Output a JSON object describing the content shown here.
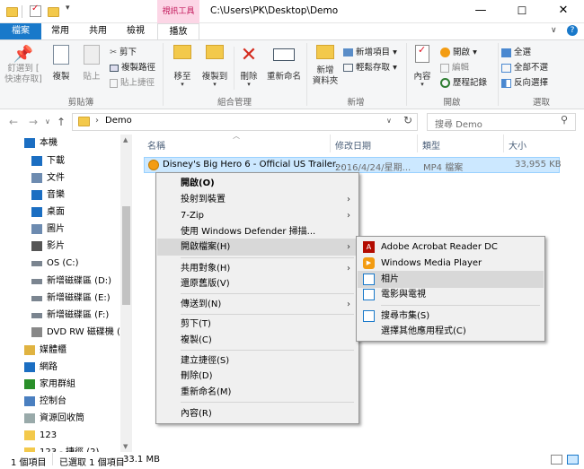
{
  "window": {
    "context_tab_group": "視訊工具",
    "path": "C:\\Users\\PK\\Desktop\\Demo",
    "minimize": "—",
    "maximize": "☐",
    "close": "✕"
  },
  "tabs": {
    "file": "檔案",
    "home": "常用",
    "share": "共用",
    "view": "檢視",
    "play": "播放"
  },
  "ribbon": {
    "pin": "釘選到 [\n快速存取]",
    "copy": "複製",
    "paste": "貼上",
    "cut": "剪下",
    "copy_path": "複製路徑",
    "paste_shortcut": "貼上捷徑",
    "move_to": "移至",
    "copy_to": "複製到",
    "delete": "刪除",
    "rename": "重新命名",
    "new_folder": "新增\n資料夾",
    "new_item": "新增項目",
    "easy_access": "輕鬆存取",
    "properties": "內容",
    "open": "開啟",
    "edit": "編輯",
    "history": "歷程記錄",
    "select_all": "全選",
    "select_none": "全部不選",
    "invert_selection": "反向選擇",
    "group_clipboard": "剪貼簿",
    "group_organize": "組合管理",
    "group_new": "新增",
    "group_open": "開啟",
    "group_select": "選取"
  },
  "address": {
    "crumb": "Demo",
    "search_placeholder": "搜尋 Demo"
  },
  "nav": {
    "items": [
      {
        "label": "本機",
        "icon": "pc-icon"
      },
      {
        "label": "下載",
        "icon": "download-icon"
      },
      {
        "label": "文件",
        "icon": "document-icon"
      },
      {
        "label": "音樂",
        "icon": "music-icon"
      },
      {
        "label": "桌面",
        "icon": "desktop-icon"
      },
      {
        "label": "圖片",
        "icon": "pictures-icon"
      },
      {
        "label": "影片",
        "icon": "videos-icon"
      },
      {
        "label": "OS (C:)",
        "icon": "drive-icon"
      },
      {
        "label": "新增磁碟區 (D:)",
        "icon": "drive-icon"
      },
      {
        "label": "新增磁碟區 (E:)",
        "icon": "drive-icon"
      },
      {
        "label": "新增磁碟區 (F:)",
        "icon": "drive-icon"
      },
      {
        "label": "DVD RW 磁碟機 (G",
        "icon": "dvd-icon"
      },
      {
        "label": "媒體櫃",
        "icon": "library-icon"
      },
      {
        "label": "網路",
        "icon": "network-icon"
      },
      {
        "label": "家用群組",
        "icon": "homegroup-icon"
      },
      {
        "label": "控制台",
        "icon": "control-panel-icon"
      },
      {
        "label": "資源回收筒",
        "icon": "recycle-bin-icon"
      },
      {
        "label": "123",
        "icon": "folder-icon"
      },
      {
        "label": "123 - 捷徑 (2)",
        "icon": "folder-icon"
      }
    ]
  },
  "columns": {
    "name": "名稱",
    "date": "修改日期",
    "type": "類型",
    "size": "大小"
  },
  "file": {
    "name": "Disney's Big Hero 6 - Official US Trailer...",
    "date": "2016/4/24/星期...",
    "type": "MP4 檔案",
    "size": "33,955 KB"
  },
  "context_menu": {
    "open": "開啟(O)",
    "cast": "投射到裝置",
    "zip": "7-Zip",
    "defender": "使用 Windows Defender 掃描...",
    "open_with": "開啟檔案(H)",
    "share_with": "共用對象(H)",
    "restore": "還原舊版(V)",
    "send_to": "傳送到(N)",
    "cut": "剪下(T)",
    "copy": "複製(C)",
    "create_shortcut": "建立捷徑(S)",
    "delete": "刪除(D)",
    "rename": "重新命名(M)",
    "properties": "內容(R)"
  },
  "submenu": {
    "acrobat": "Adobe Acrobat Reader DC",
    "wmp": "Windows Media Player",
    "photos": "相片",
    "movies_tv": "電影與電視",
    "store": "搜尋市集(S)",
    "choose_other": "選擇其他應用程式(C)"
  },
  "status": {
    "count": "1 個項目",
    "selected": "已選取 1 個項目",
    "size": "33.1 MB"
  },
  "colors": {
    "accent": "#1979ca",
    "selection": "#cce8ff",
    "context_tab": "#fcd6e6"
  }
}
